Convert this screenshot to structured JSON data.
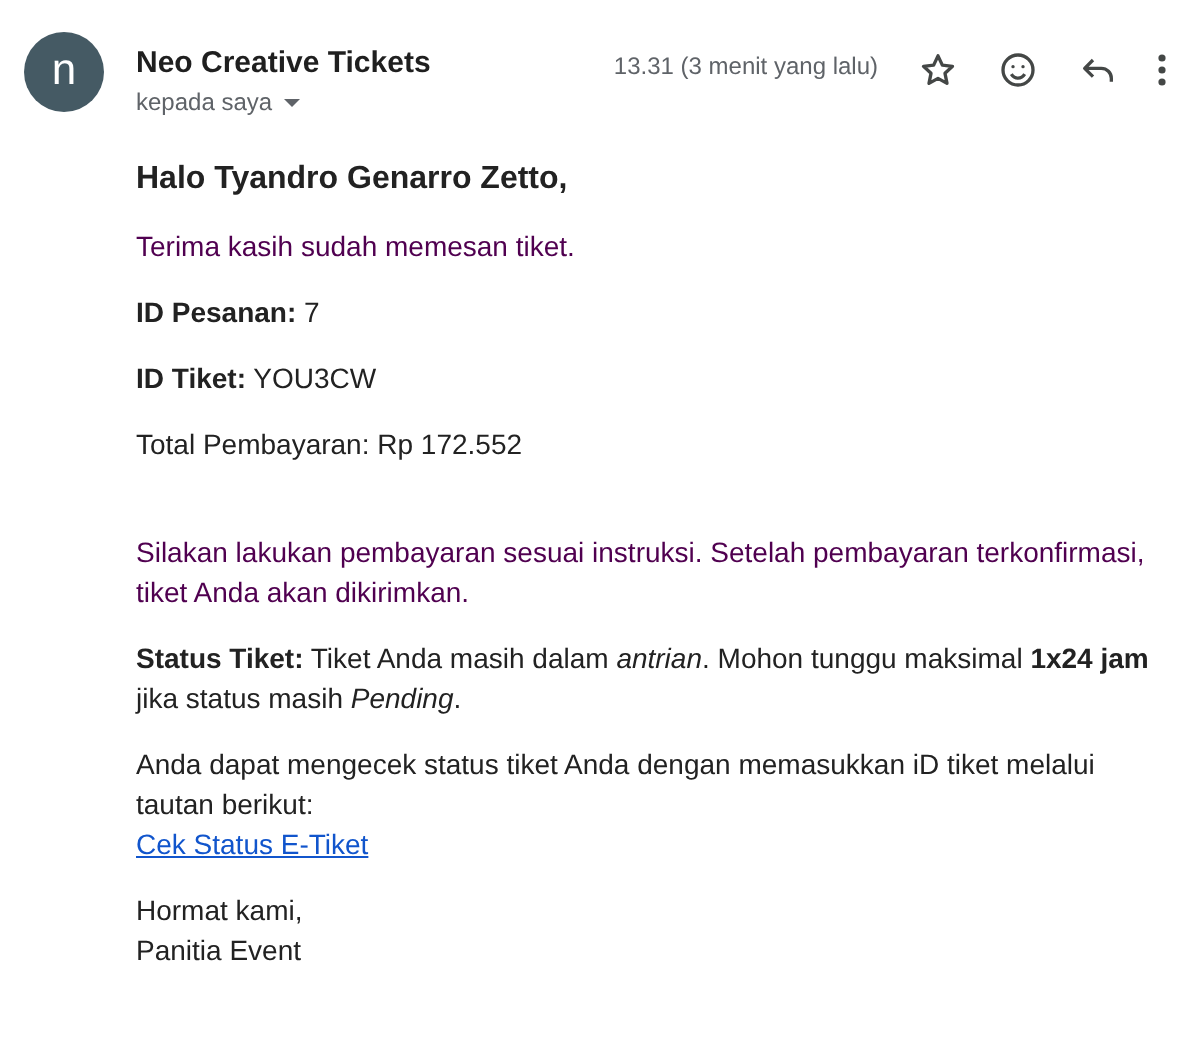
{
  "header": {
    "avatar_letter": "n",
    "sender": "Neo Creative Tickets",
    "recipient": "kepada saya",
    "time": "13.31 (3 menit yang lalu)",
    "starred": false
  },
  "greeting": "Halo Tyandro Genarro Zetto,",
  "sections": [
    [
      {
        "kind": "quoted",
        "text": "Terima kasih sudah memesan tiket."
      },
      {
        "kind": "plain",
        "text": "**ID Pesanan:** 7"
      },
      {
        "kind": "plain",
        "text": "**ID Tiket:** YOU3CW"
      },
      {
        "kind": "plain",
        "text": "Total Pembayaran: Rp 172.552"
      }
    ],
    [
      {
        "kind": "quoted",
        "text": "Silakan lakukan pembayaran sesuai instruksi. Setelah pembayaran terkonfirmasi, tiket Anda akan dikirimkan."
      },
      {
        "kind": "plain",
        "text": "**Status Tiket:** Tiket Anda masih dalam *antrian*. Mohon tunggu maksimal **1x24 jam** jika status masih *Pending*."
      },
      {
        "kind": "plain",
        "text": "Anda dapat mengecek status tiket Anda dengan memasukkan iD tiket melalui tautan berikut:",
        "link": "Cek Status E-Tiket"
      },
      {
        "kind": "plain",
        "lines": [
          "Hormat kami,",
          "Panitia Event"
        ]
      }
    ]
  ]
}
